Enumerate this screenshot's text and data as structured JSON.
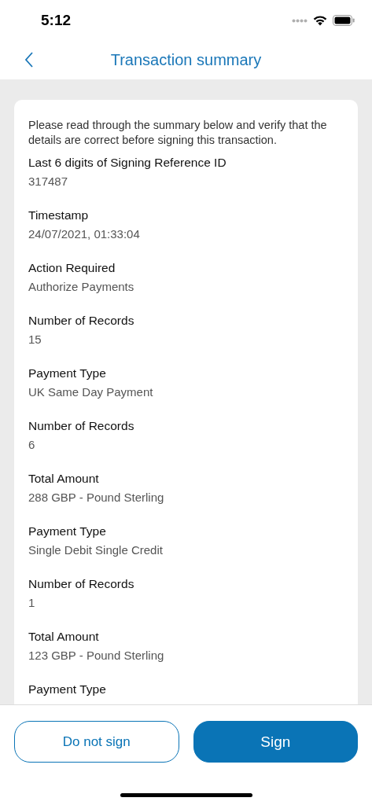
{
  "status_bar": {
    "time": "5:12"
  },
  "header": {
    "title": "Transaction summary"
  },
  "intro": "Please read through the summary below and verify that the details are correct before signing this transaction.",
  "fields": [
    {
      "label": "Last 6 digits of Signing Reference ID",
      "value": "317487"
    },
    {
      "label": "Timestamp",
      "value": "24/07/2021, 01:33:04"
    },
    {
      "label": "Action Required",
      "value": "Authorize Payments"
    },
    {
      "label": "Number of Records",
      "value": "15"
    },
    {
      "label": "Payment Type",
      "value": "UK Same Day Payment"
    },
    {
      "label": "Number of Records",
      "value": "6"
    },
    {
      "label": "Total Amount",
      "value": "288 GBP - Pound Sterling"
    },
    {
      "label": "Payment Type",
      "value": "Single Debit Single Credit"
    },
    {
      "label": "Number of Records",
      "value": "1"
    },
    {
      "label": "Total Amount",
      "value": "123 GBP - Pound Sterling"
    },
    {
      "label": "Payment Type"
    }
  ],
  "buttons": [
    {
      "label": "Do not sign",
      "kind": "secondary"
    },
    {
      "label": "Sign",
      "kind": "primary"
    }
  ]
}
